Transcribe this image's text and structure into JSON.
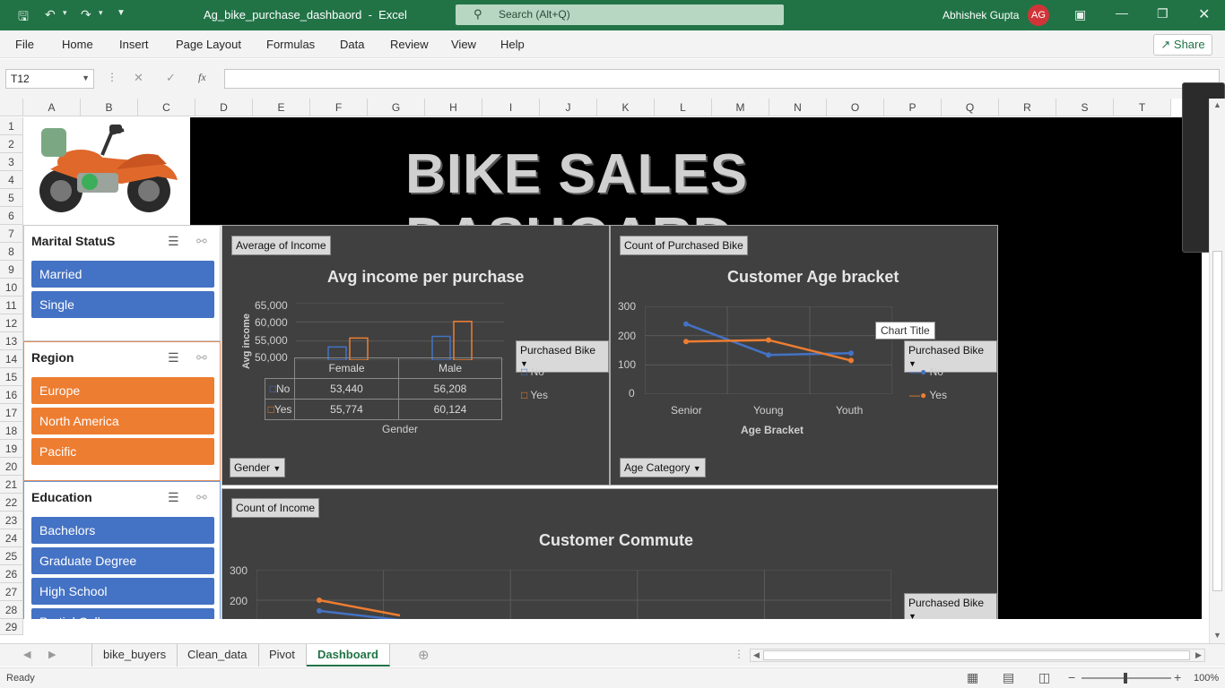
{
  "titlebar": {
    "filename": "Ag_bike_purchase_dashbaord",
    "app": "Excel",
    "search_placeholder": "Search (Alt+Q)",
    "user": "Abhishek Gupta",
    "avatar_initials": "AG"
  },
  "menu": [
    "File",
    "Home",
    "Insert",
    "Page Layout",
    "Formulas",
    "Data",
    "Review",
    "View",
    "Help"
  ],
  "share_label": "Share",
  "formula_bar": {
    "name_box": "T12",
    "fx": "fx",
    "value": ""
  },
  "columns": [
    "A",
    "B",
    "C",
    "D",
    "E",
    "F",
    "G",
    "H",
    "I",
    "J",
    "K",
    "L",
    "M",
    "N",
    "O",
    "P",
    "Q",
    "R",
    "S",
    "T"
  ],
  "rows": [
    "1",
    "2",
    "3",
    "4",
    "5",
    "6",
    "7",
    "8",
    "9",
    "10",
    "11",
    "12",
    "13",
    "14",
    "15",
    "16",
    "17",
    "18",
    "19",
    "20",
    "21",
    "22",
    "23",
    "24",
    "25",
    "26",
    "27",
    "28",
    "29"
  ],
  "dashboard_title": "BIKE SALES DASHOARD",
  "slicers": {
    "marital": {
      "title": "Marital StatuS",
      "items": [
        "Married",
        "Single"
      ]
    },
    "region": {
      "title": "Region",
      "items": [
        "Europe",
        "North America",
        "Pacific"
      ]
    },
    "education": {
      "title": "Education",
      "items": [
        "Bachelors",
        "Graduate Degree",
        "High School",
        "Partial College"
      ]
    }
  },
  "chart1": {
    "field_value": "Average of Income",
    "title": "Avg income per purchase",
    "ylabel": "Avg income",
    "yticks": [
      "65,000",
      "60,000",
      "55,000",
      "50,000"
    ],
    "legend_field": "Purchased Bike",
    "legend": [
      "No",
      "Yes"
    ],
    "axis_field": "Gender",
    "xlabel": "Gender",
    "table_header": [
      "Female",
      "Male"
    ],
    "table_rows": [
      {
        "name": "No",
        "values": [
          "53,440",
          "56,208"
        ]
      },
      {
        "name": "Yes",
        "values": [
          "55,774",
          "60,124"
        ]
      }
    ]
  },
  "chart2": {
    "field_value": "Count of Purchased Bike",
    "title": "Customer Age bracket",
    "yticks": [
      "300",
      "200",
      "100",
      "0"
    ],
    "categories": [
      "Senior",
      "Young",
      "Youth"
    ],
    "xlabel": "Age Bracket",
    "legend_field": "Purchased Bike",
    "legend": [
      "No",
      "Yes"
    ],
    "axis_field": "Age Category",
    "tooltip": "Chart Title"
  },
  "chart3": {
    "field_value": "Count of Income",
    "title": "Customer Commute",
    "yticks": [
      "300",
      "200"
    ],
    "legend_field": "Purchased Bike"
  },
  "chart_data": [
    {
      "type": "bar",
      "title": "Avg income per purchase",
      "xlabel": "Gender",
      "ylabel": "Avg income",
      "categories": [
        "Female",
        "Male"
      ],
      "series": [
        {
          "name": "No",
          "values": [
            53440,
            56208
          ]
        },
        {
          "name": "Yes",
          "values": [
            55774,
            60124
          ]
        }
      ],
      "ylim": [
        50000,
        65000
      ],
      "colors": [
        "#4472c4",
        "#ed7d31"
      ]
    },
    {
      "type": "line",
      "title": "Customer Age bracket",
      "xlabel": "Age Bracket",
      "categories": [
        "Senior",
        "Young",
        "Youth"
      ],
      "series": [
        {
          "name": "No",
          "values": [
            240,
            134,
            140
          ]
        },
        {
          "name": "Yes",
          "values": [
            180,
            185,
            115
          ]
        }
      ],
      "ylim": [
        0,
        300
      ],
      "colors": [
        "#4472c4",
        "#ed7d31"
      ]
    },
    {
      "type": "line",
      "title": "Customer Commute",
      "series": [
        {
          "name": "No",
          "values": [
            165,
            135
          ]
        },
        {
          "name": "Yes",
          "values": [
            200,
            150
          ]
        }
      ],
      "ylim": [
        0,
        300
      ],
      "colors": [
        "#4472c4",
        "#ed7d31"
      ]
    }
  ],
  "sheet_tabs": [
    "bike_buyers",
    "Clean_data",
    "Pivot",
    "Dashboard"
  ],
  "active_tab": "Dashboard",
  "status": {
    "text": "Ready",
    "zoom": "100%"
  }
}
